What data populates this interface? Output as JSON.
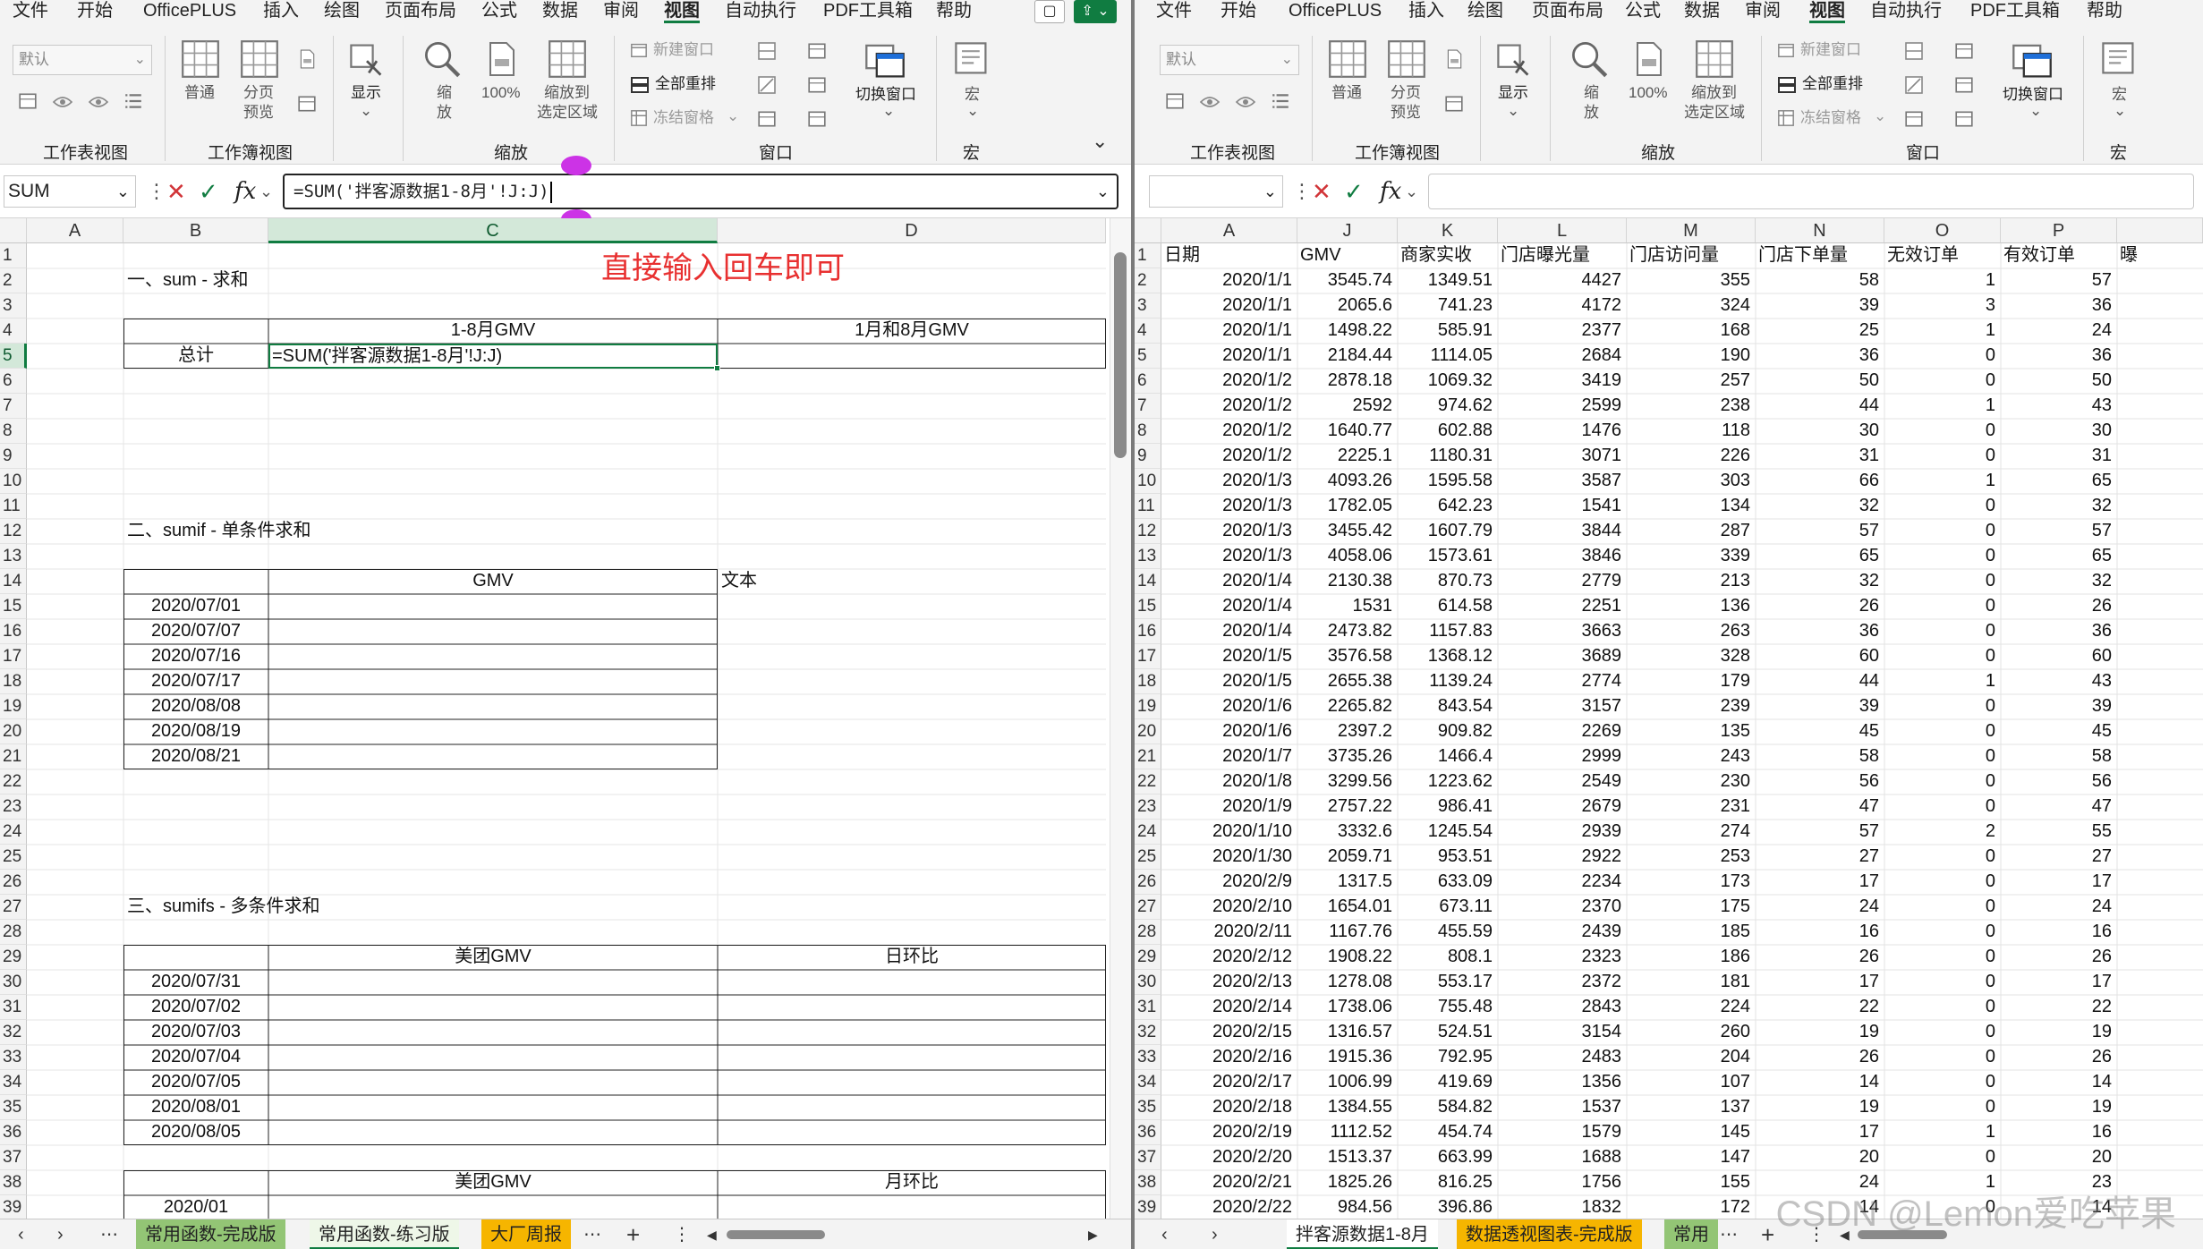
{
  "menu_tabs": [
    "文件",
    "开始",
    "OfficePLUS",
    "插入",
    "绘图",
    "页面布局",
    "公式",
    "数据",
    "审阅",
    "视图",
    "自动执行",
    "PDF工具箱",
    "帮助"
  ],
  "active_menu": "视图",
  "ribbon": {
    "view_default": "默认",
    "normal": "普通",
    "page_break": "分页",
    "page_break2": "预览",
    "workbook_views": "工作表视图",
    "workbook_view": "工作簿视图",
    "show": "显示",
    "zoom1": "缩",
    "zoom2": "放",
    "zoom100": "100%",
    "zoom_sel1": "缩放到",
    "zoom_sel2": "选定区域",
    "zoom_group": "缩放",
    "new_window": "新建窗口",
    "arrange_all": "全部重排",
    "freeze": "冻结窗格",
    "switch_window": "切换窗口",
    "window_group": "窗口",
    "macro": "宏",
    "macro_group": "宏"
  },
  "left": {
    "name_box": "SUM",
    "formula": "=SUM('拌客源数据1-8月'!J:J)",
    "annotation": "直接输入回车即可",
    "columns": [
      "A",
      "B",
      "C",
      "D"
    ],
    "rows": [
      "1",
      "2",
      "3",
      "4",
      "5",
      "6",
      "7",
      "8",
      "9",
      "10",
      "11",
      "12",
      "13",
      "14",
      "15",
      "16",
      "17",
      "18",
      "19",
      "20",
      "21",
      "22",
      "23",
      "24",
      "25",
      "26",
      "27",
      "28",
      "29",
      "30",
      "31",
      "32",
      "33",
      "34",
      "35",
      "36",
      "37",
      "38",
      "39"
    ],
    "s1_title": "一、sum - 求和",
    "s1_h1": "1-8月GMV",
    "s1_h2": "1月和8月GMV",
    "s1_total": "总计",
    "s1_edit": "=SUM('拌客源数据1-8月'!J:J)",
    "s2_title": "二、sumif - 单条件求和",
    "s2_h1": "GMV",
    "s2_text": "文本",
    "s2_dates": [
      "2020/07/01",
      "2020/07/07",
      "2020/07/16",
      "2020/07/17",
      "2020/08/08",
      "2020/08/19",
      "2020/08/21"
    ],
    "s3_title": "三、sumifs - 多条件求和",
    "s3_h1": "美团GMV",
    "s3_h2": "日环比",
    "s3_dates": [
      "2020/07/31",
      "2020/07/02",
      "2020/07/03",
      "2020/07/04",
      "2020/07/05",
      "2020/08/01",
      "2020/08/05"
    ],
    "s4_h1": "美团GMV",
    "s4_h2": "月环比",
    "s4_date": "2020/01",
    "tabs": [
      "常用函数-完成版",
      "常用函数-练习版",
      "大厂周报"
    ]
  },
  "right": {
    "columns": [
      "A",
      "J",
      "K",
      "L",
      "M",
      "N",
      "O",
      "P"
    ],
    "headers": [
      "日期",
      "GMV",
      "商家实收",
      "门店曝光量",
      "门店访问量",
      "门店下单量",
      "无效订单",
      "有效订单",
      "曝"
    ],
    "data": [
      [
        "2020/1/1",
        "3545.74",
        "1349.51",
        "4427",
        "355",
        "58",
        "1",
        "57"
      ],
      [
        "2020/1/1",
        "2065.6",
        "741.23",
        "4172",
        "324",
        "39",
        "3",
        "36"
      ],
      [
        "2020/1/1",
        "1498.22",
        "585.91",
        "2377",
        "168",
        "25",
        "1",
        "24"
      ],
      [
        "2020/1/1",
        "2184.44",
        "1114.05",
        "2684",
        "190",
        "36",
        "0",
        "36"
      ],
      [
        "2020/1/2",
        "2878.18",
        "1069.32",
        "3419",
        "257",
        "50",
        "0",
        "50"
      ],
      [
        "2020/1/2",
        "2592",
        "974.62",
        "2599",
        "238",
        "44",
        "1",
        "43"
      ],
      [
        "2020/1/2",
        "1640.77",
        "602.88",
        "1476",
        "118",
        "30",
        "0",
        "30"
      ],
      [
        "2020/1/2",
        "2225.1",
        "1180.31",
        "3071",
        "226",
        "31",
        "0",
        "31"
      ],
      [
        "2020/1/3",
        "4093.26",
        "1595.58",
        "3587",
        "303",
        "66",
        "1",
        "65"
      ],
      [
        "2020/1/3",
        "1782.05",
        "642.23",
        "1541",
        "134",
        "32",
        "0",
        "32"
      ],
      [
        "2020/1/3",
        "3455.42",
        "1607.79",
        "3844",
        "287",
        "57",
        "0",
        "57"
      ],
      [
        "2020/1/3",
        "4058.06",
        "1573.61",
        "3846",
        "339",
        "65",
        "0",
        "65"
      ],
      [
        "2020/1/4",
        "2130.38",
        "870.73",
        "2779",
        "213",
        "32",
        "0",
        "32"
      ],
      [
        "2020/1/4",
        "1531",
        "614.58",
        "2251",
        "136",
        "26",
        "0",
        "26"
      ],
      [
        "2020/1/4",
        "2473.82",
        "1157.83",
        "3663",
        "263",
        "36",
        "0",
        "36"
      ],
      [
        "2020/1/5",
        "3576.58",
        "1368.12",
        "3689",
        "328",
        "60",
        "0",
        "60"
      ],
      [
        "2020/1/5",
        "2655.38",
        "1139.24",
        "2774",
        "179",
        "44",
        "1",
        "43"
      ],
      [
        "2020/1/6",
        "2265.82",
        "843.54",
        "3157",
        "239",
        "39",
        "0",
        "39"
      ],
      [
        "2020/1/6",
        "2397.2",
        "909.82",
        "2269",
        "135",
        "45",
        "0",
        "45"
      ],
      [
        "2020/1/7",
        "3735.26",
        "1466.4",
        "2999",
        "243",
        "58",
        "0",
        "58"
      ],
      [
        "2020/1/8",
        "3299.56",
        "1223.62",
        "2549",
        "230",
        "56",
        "0",
        "56"
      ],
      [
        "2020/1/9",
        "2757.22",
        "986.41",
        "2679",
        "231",
        "47",
        "0",
        "47"
      ],
      [
        "2020/1/10",
        "3332.6",
        "1245.54",
        "2939",
        "274",
        "57",
        "2",
        "55"
      ],
      [
        "2020/1/30",
        "2059.71",
        "953.51",
        "2922",
        "253",
        "27",
        "0",
        "27"
      ],
      [
        "2020/2/9",
        "1317.5",
        "633.09",
        "2234",
        "173",
        "17",
        "0",
        "17"
      ],
      [
        "2020/2/10",
        "1654.01",
        "673.11",
        "2370",
        "175",
        "24",
        "0",
        "24"
      ],
      [
        "2020/2/11",
        "1167.76",
        "455.59",
        "2439",
        "185",
        "16",
        "0",
        "16"
      ],
      [
        "2020/2/12",
        "1908.22",
        "808.1",
        "2323",
        "186",
        "26",
        "0",
        "26"
      ],
      [
        "2020/2/13",
        "1278.08",
        "553.17",
        "2372",
        "181",
        "17",
        "0",
        "17"
      ],
      [
        "2020/2/14",
        "1738.06",
        "755.48",
        "2843",
        "224",
        "22",
        "0",
        "22"
      ],
      [
        "2020/2/15",
        "1316.57",
        "524.51",
        "3154",
        "260",
        "19",
        "0",
        "19"
      ],
      [
        "2020/2/16",
        "1915.36",
        "792.95",
        "2483",
        "204",
        "26",
        "0",
        "26"
      ],
      [
        "2020/2/17",
        "1006.99",
        "419.69",
        "1356",
        "107",
        "14",
        "0",
        "14"
      ],
      [
        "2020/2/18",
        "1384.55",
        "584.82",
        "1537",
        "137",
        "19",
        "0",
        "19"
      ],
      [
        "2020/2/19",
        "1112.52",
        "454.74",
        "1579",
        "145",
        "17",
        "1",
        "16"
      ],
      [
        "2020/2/20",
        "1513.37",
        "663.99",
        "1688",
        "147",
        "20",
        "0",
        "20"
      ],
      [
        "2020/2/21",
        "1825.26",
        "816.25",
        "1756",
        "155",
        "24",
        "1",
        "23"
      ],
      [
        "2020/2/22",
        "984.56",
        "396.86",
        "1832",
        "172",
        "14",
        "0",
        "14"
      ]
    ],
    "tabs": [
      "拌客源数据1-8月",
      "数据透视图表-完成版",
      "常用"
    ]
  },
  "watermark": "CSDN @Lemon爱吃苹果"
}
